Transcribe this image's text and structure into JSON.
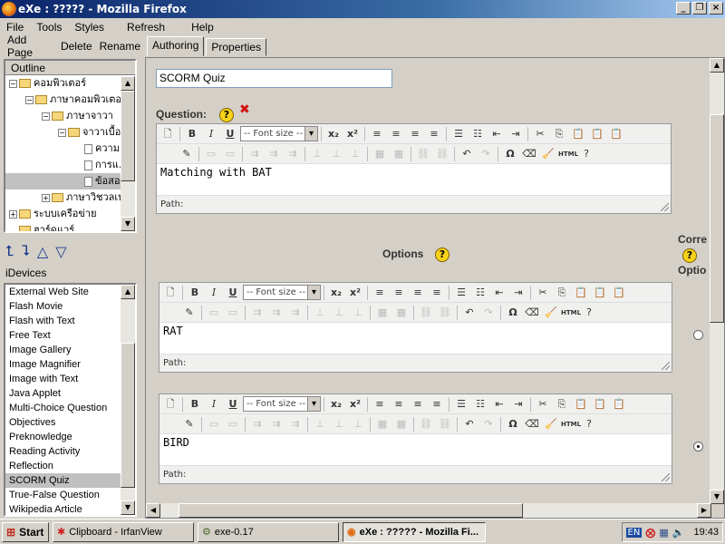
{
  "window": {
    "title": "eXe : ????? - Mozilla Firefox"
  },
  "menu": [
    "File",
    "Tools",
    "Styles",
    "Refresh",
    "Help"
  ],
  "left": {
    "buttons": [
      "Add Page",
      "Delete",
      "Rename"
    ],
    "outline_header": "Outline",
    "tree": [
      {
        "label": "คอมพิวเตอร์",
        "level": 0,
        "exp": "−"
      },
      {
        "label": "ภาษาคอมพิวเตอร์",
        "level": 1,
        "exp": "−"
      },
      {
        "label": "ภาษาจาวา",
        "level": 2,
        "exp": "−"
      },
      {
        "label": "จาวาเบื้อ...",
        "level": 3,
        "exp": "−"
      },
      {
        "label": "ความ...",
        "level": 4,
        "exp": ""
      },
      {
        "label": "การแ...",
        "level": 4,
        "exp": ""
      },
      {
        "label": "ข้อสอบ",
        "level": 4,
        "exp": "",
        "selected": true
      },
      {
        "label": "ภาษาวิชวลเบ...",
        "level": 2,
        "exp": "+"
      },
      {
        "label": "ระบบเครือข่าย",
        "level": 0,
        "exp": "+"
      },
      {
        "label": "ฮาร์ดแวร์",
        "level": 0,
        "exp": ""
      }
    ],
    "idevices_label": "iDevices",
    "idevices": [
      "External Web Site",
      "Flash Movie",
      "Flash with Text",
      "Free Text",
      "Image Gallery",
      "Image Magnifier",
      "Image with Text",
      "Java Applet",
      "Multi-Choice Question",
      "Objectives",
      "Preknowledge",
      "Reading Activity",
      "Reflection",
      "SCORM Quiz",
      "True-False Question",
      "Wikipedia Article"
    ],
    "idevices_selected": "SCORM Quiz"
  },
  "tabs": [
    "Authoring",
    "Properties"
  ],
  "active_tab": "Authoring",
  "main": {
    "title_value": "SCORM Quiz",
    "question_label": "Question:",
    "question_text": "Matching with BAT",
    "options_label": "Options",
    "correct_label_1": "Corre",
    "correct_label_2": "Optio",
    "options": [
      {
        "text": "RAT",
        "correct": false
      },
      {
        "text": "BIRD",
        "correct": true
      }
    ],
    "editor": {
      "font_size_placeholder": "-- Font size --",
      "path_label": "Path:",
      "html_label": "HTML"
    }
  },
  "taskbar": {
    "start": "Start",
    "items": [
      "Clipboard - IrfanView",
      "exe-0.17",
      "eXe : ????? - Mozilla Fi..."
    ],
    "active_item": "eXe : ????? - Mozilla Fi...",
    "lang": "EN",
    "clock": "19:43"
  }
}
